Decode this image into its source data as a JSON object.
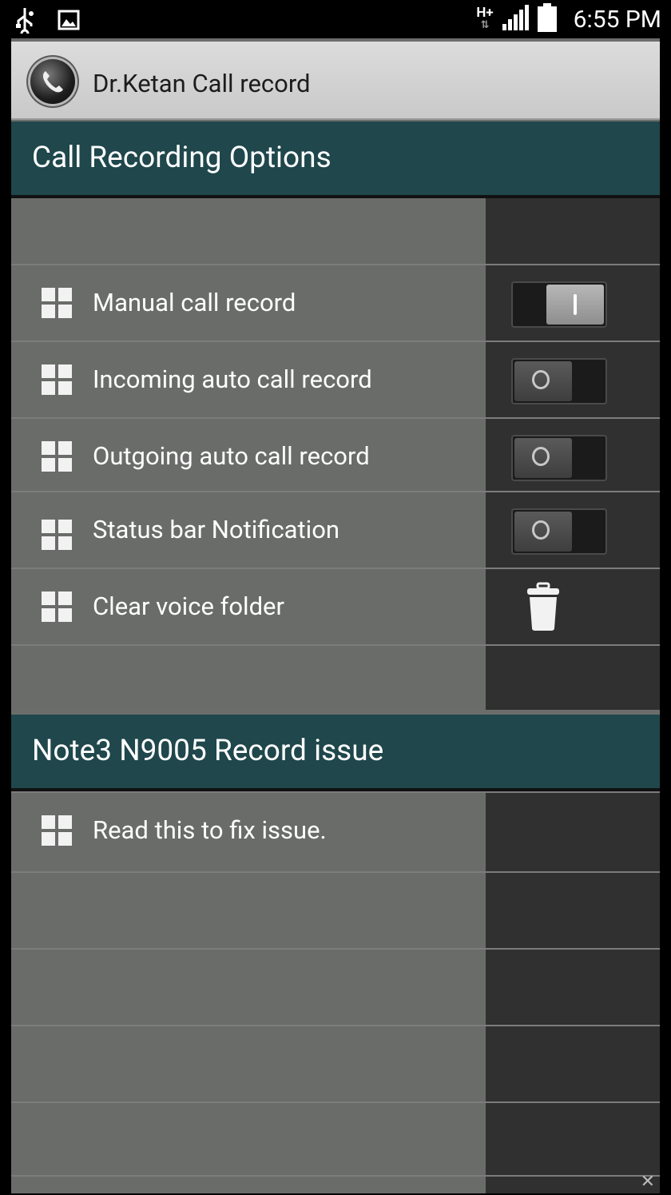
{
  "status_bar": {
    "time": "6:55 PM",
    "network": "H+",
    "icons": [
      "usb-icon",
      "image-icon",
      "signal-icon",
      "battery-icon"
    ]
  },
  "app": {
    "title": "Dr.Ketan Call record",
    "icon": "phone-icon"
  },
  "sections": [
    {
      "header": "Call Recording Options",
      "items": [
        {
          "label": "Manual call record",
          "control": "toggle",
          "state": "on"
        },
        {
          "label": "Incoming auto call record",
          "control": "toggle",
          "state": "off"
        },
        {
          "label": "Outgoing auto call record",
          "control": "toggle",
          "state": "off"
        },
        {
          "label": "Status bar Notification",
          "control": "toggle",
          "state": "off"
        },
        {
          "label": "Clear voice folder",
          "control": "trash-icon"
        }
      ]
    },
    {
      "header": "Note3 N9005 Record issue",
      "items": [
        {
          "label": "Read this to fix issue."
        }
      ]
    }
  ],
  "colors": {
    "header_bg": "#1f474c",
    "list_bg": "#6a6c6a",
    "right_column_bg": "#2f302f",
    "title_bar_bg": "#d4d4d4"
  }
}
